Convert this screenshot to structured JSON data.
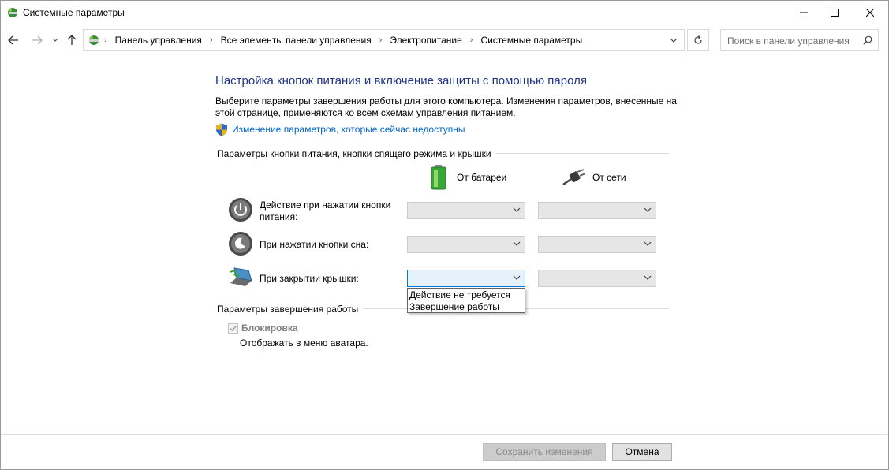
{
  "window": {
    "title": "Системные параметры"
  },
  "address": {
    "crumbs": [
      "Панель управления",
      "Все элементы панели управления",
      "Электропитание",
      "Системные параметры"
    ]
  },
  "search": {
    "placeholder": "Поиск в панели управления"
  },
  "page": {
    "heading": "Настройка кнопок питания и включение защиты с помощью пароля",
    "description": "Выберите параметры завершения работы для этого компьютера. Изменения параметров, внесенные на этой странице, применяются ко всем схемам управления питанием.",
    "change_link": "Изменение параметров, которые сейчас недоступны"
  },
  "power_section": {
    "label": "Параметры кнопки питания, кнопки спящего режима и крышки",
    "columns": {
      "battery": "От батареи",
      "ac": "От сети"
    },
    "rows": [
      {
        "label": "Действие при нажатии кнопки питания:",
        "icon": "power-button-icon"
      },
      {
        "label": "При нажатии кнопки сна:",
        "icon": "sleep-button-icon"
      },
      {
        "label": "При закрытии крышки:",
        "icon": "laptop-lid-icon"
      }
    ],
    "dropdown_options": [
      "Действие не требуется",
      "Завершение работы"
    ]
  },
  "shutdown_section": {
    "label": "Параметры завершения работы",
    "lock_label": "Блокировка",
    "lock_desc": "Отображать в меню аватара.",
    "lock_checked": true
  },
  "footer": {
    "save": "Сохранить изменения",
    "cancel": "Отмена"
  },
  "colors": {
    "heading": "#1e3287",
    "link": "#0066cc",
    "focus": "#0078d7"
  }
}
